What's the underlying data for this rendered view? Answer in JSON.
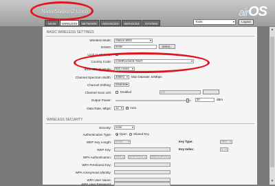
{
  "header": {
    "device_name": "NanoStation2 Loco",
    "brand_air": "air",
    "brand_os": "OS"
  },
  "tabs": [
    {
      "label": "MAIN"
    },
    {
      "label": "WIRELESS"
    },
    {
      "label": "NETWORK"
    },
    {
      "label": "ADVANCED"
    },
    {
      "label": "SERVICES"
    },
    {
      "label": "SYSTEM"
    }
  ],
  "toolbar": {
    "tools_value": "Tools:",
    "logout_label": "Logout"
  },
  "basic": {
    "title": "BASIC WIRELESS SETTINGS",
    "wireless_mode_label": "Wireless Mode:",
    "wireless_mode_value": "Station WDS",
    "essid_label": "ESSID:",
    "essid_value": "tester",
    "select_button": "Select...",
    "lock_ap_label": "Lock to AP MAC:",
    "country_label": "Country Code:",
    "country_value": "COMPLIANCE TEST",
    "ieee_label": "IEEE 802.11 Mode:",
    "ieee_value": "B/G mixed",
    "width_label": "Channel Spectrum Width:",
    "width_value": "20MHz",
    "max_datarate": "Max Datarate: 54Mbps",
    "shifting_label": "Channel Shifting:",
    "shifting_value": "Disabled",
    "scan_label": "Channel Scan List:",
    "scan_enabled": "Enabled",
    "scan_value": "2/6",
    "power_label": "Output Power:",
    "power_value": "20",
    "power_unit": "dBm",
    "power_fraction": 0.95,
    "rate_label": "Data Rate, Mbps:",
    "rate_value": "12",
    "rate_auto": "Auto"
  },
  "security": {
    "title": "WIRELESS SECURITY",
    "security_label": "Security:",
    "security_value": "none",
    "auth_type_label": "Authentication Type:",
    "auth_open": "Open",
    "auth_shared": "Shared Key",
    "wep_length_label": "WEP Key Length:",
    "wep_length_value": "64-bit",
    "key_type_label": "Key Type:",
    "key_type_value": "HEX",
    "wep_key_label": "WEP Key:",
    "key_index_label": "Key Index:",
    "key_index_value": "1",
    "wpa_auth_label": "WPA Authentication:",
    "wpa_auth_a": "PSK",
    "wpa_auth_b": "EAP-TTLS",
    "wpa_auth_c": "MSCHAPV2",
    "psk_label": "WPA Preshared Key:",
    "anon_label": "WPA Anonymous Identity:",
    "user_label": "WPA User Name:",
    "pass_label": "WPA User Password:"
  },
  "colors": {
    "highlight": "#e0141c",
    "panel": "#f5f5f5",
    "header": "#b5b5b5"
  }
}
